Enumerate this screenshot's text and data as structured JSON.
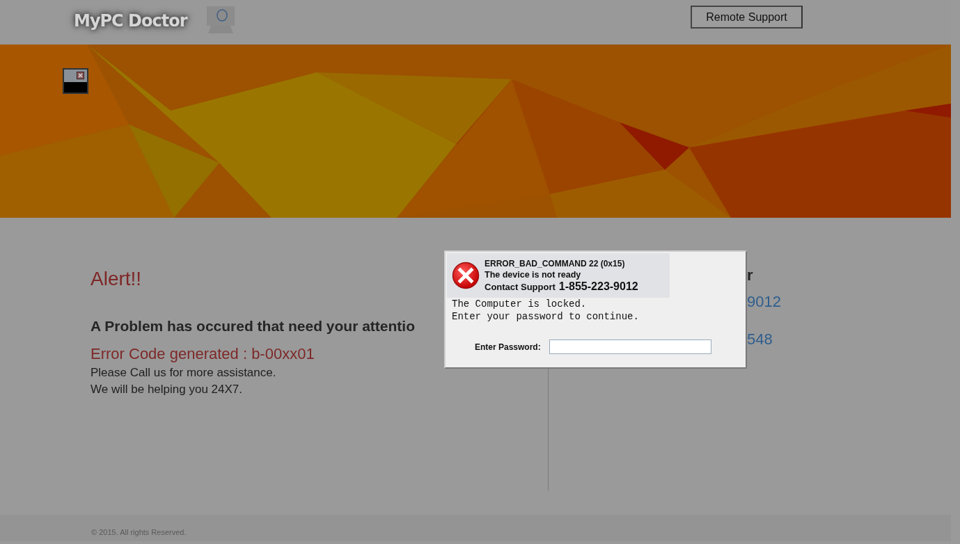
{
  "header": {
    "logo": "MyPC Doctor",
    "remote_support_button": "Remote Support"
  },
  "alert": {
    "title": "Alert!!",
    "heading": "A Problem has occured that need your attentio",
    "error_code": "Error Code generated : b-00xx01",
    "lines": [
      "Please Call us for more assistance.",
      "We will be helping you 24X7."
    ]
  },
  "side_panel": {
    "title": "r",
    "phones": [
      "9012",
      "548"
    ]
  },
  "dialog": {
    "error_title": "ERROR_BAD_COMMAND 22 (0x15)",
    "error_message": "The device is not ready",
    "contact_label": "Contact Support",
    "contact_phone": "1-855-223-9012",
    "message_lines": [
      "The Computer is locked.",
      "Enter your password to continue."
    ],
    "password_label": "Enter Password:"
  },
  "footer": {
    "copyright": "© 2015. All rights Reserved."
  }
}
